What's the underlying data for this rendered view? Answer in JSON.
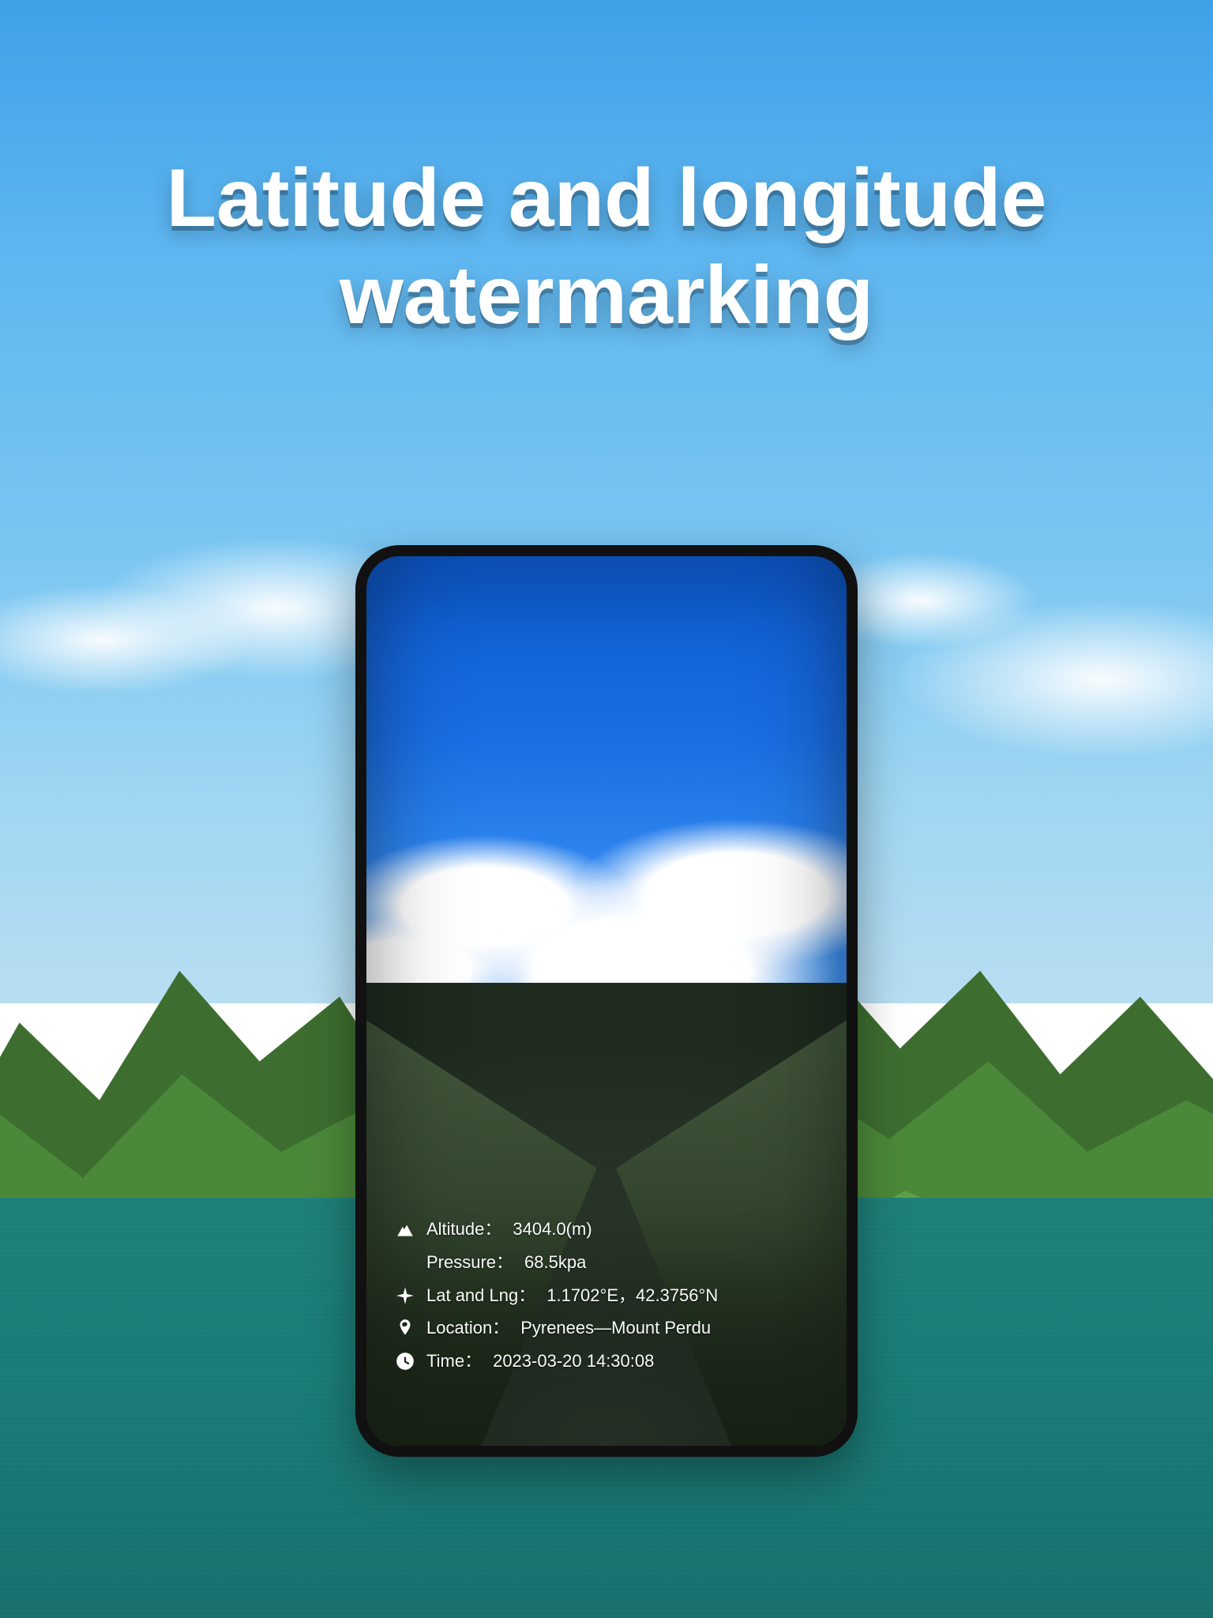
{
  "title_line1": "Latitude and longitude",
  "title_line2": "watermarking",
  "watermark": {
    "altitude": {
      "label": "Altitude：",
      "value": "3404.0(m)"
    },
    "pressure": {
      "label": "Pressure：",
      "value": "68.5kpa"
    },
    "latlng": {
      "label": "Lat and Lng：",
      "value": "1.1702°E，42.3756°N"
    },
    "location": {
      "label": "Location：",
      "value": "Pyrenees—Mount Perdu"
    },
    "time": {
      "label": "Time：",
      "value": "2023-03-20 14:30:08"
    }
  }
}
